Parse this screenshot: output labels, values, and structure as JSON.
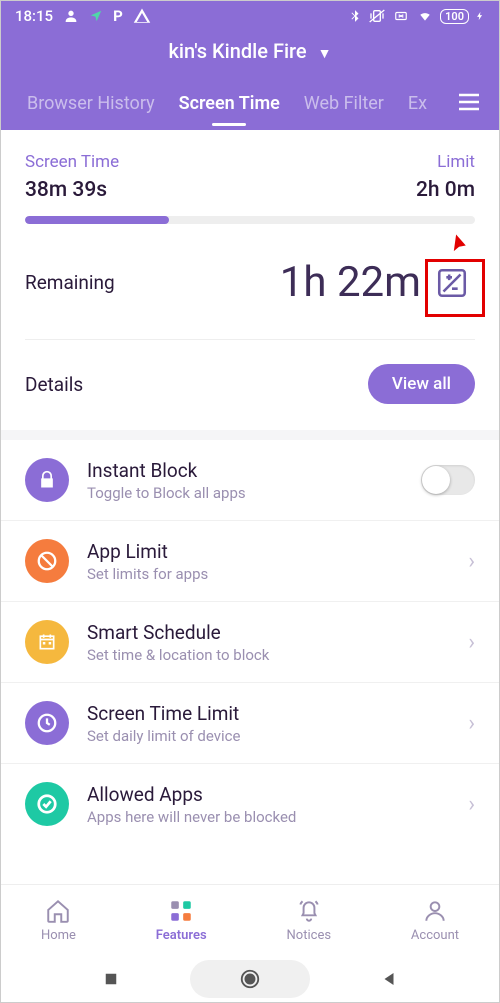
{
  "statusBar": {
    "time": "18:15",
    "battery": "100"
  },
  "device": {
    "name": "kin's Kindle Fire"
  },
  "tabs": {
    "items": [
      "Browser History",
      "Screen Time",
      "Web Filter",
      "Ex"
    ],
    "activeIndex": 1
  },
  "screenTime": {
    "usedLabel": "Screen Time",
    "usedValue": "38m 39s",
    "limitLabel": "Limit",
    "limitValue": "2h 0m",
    "remainingLabel": "Remaining",
    "remainingValue": "1h 22m"
  },
  "details": {
    "label": "Details",
    "viewAll": "View all"
  },
  "options": [
    {
      "title": "Instant Block",
      "sub": "Toggle to Block all apps",
      "icon": "lock",
      "color": "ic-purple",
      "control": "toggle"
    },
    {
      "title": "App Limit",
      "sub": "Set limits for apps",
      "icon": "block",
      "color": "ic-orange",
      "control": "chevron"
    },
    {
      "title": "Smart Schedule",
      "sub": "Set time & location to block",
      "icon": "calendar",
      "color": "ic-yellow",
      "control": "chevron"
    },
    {
      "title": "Screen Time Limit",
      "sub": "Set daily limit of device",
      "icon": "clock",
      "color": "ic-purple",
      "control": "chevron"
    },
    {
      "title": "Allowed Apps",
      "sub": "Apps here will never be blocked",
      "icon": "check",
      "color": "ic-teal",
      "control": "chevron"
    }
  ],
  "bottomNav": {
    "items": [
      "Home",
      "Features",
      "Notices",
      "Account"
    ],
    "activeIndex": 1
  }
}
